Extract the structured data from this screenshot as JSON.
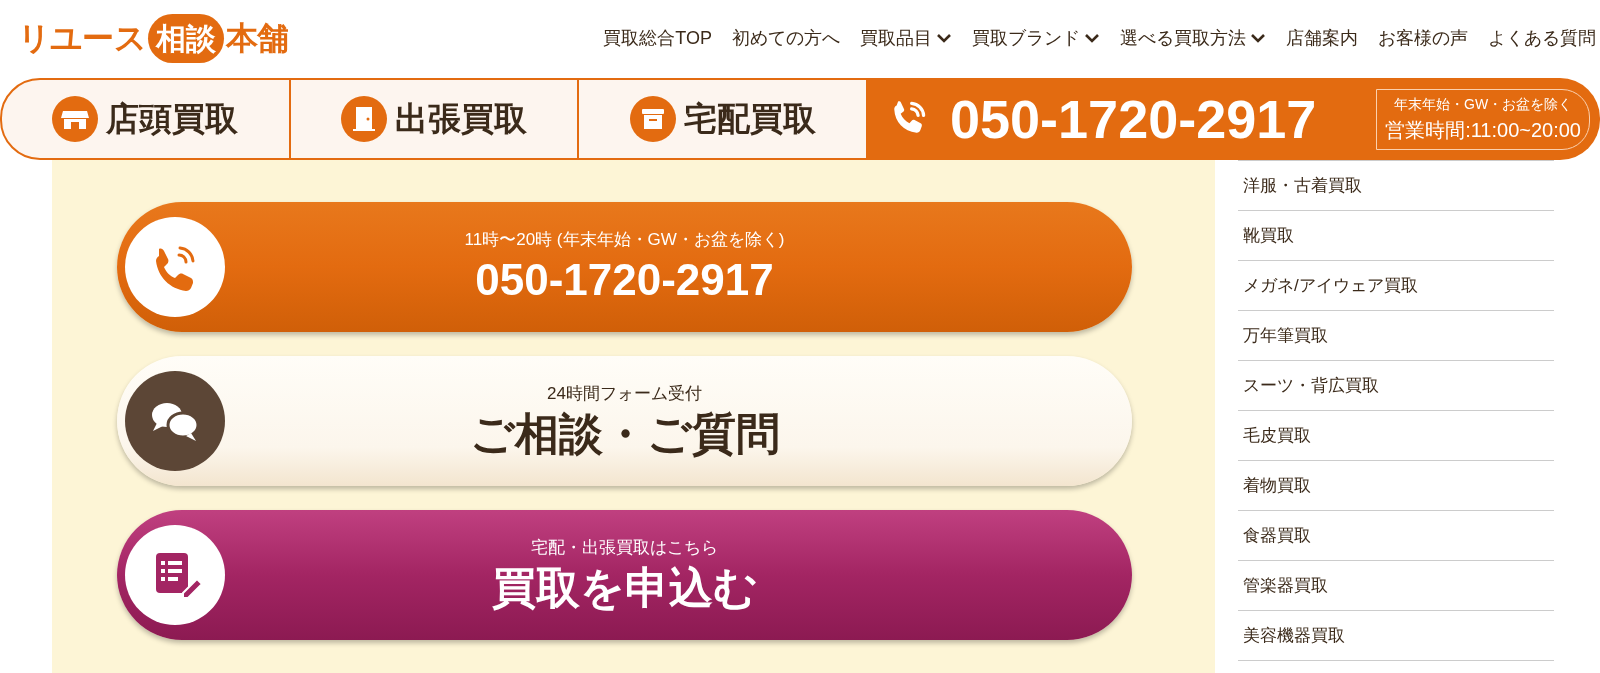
{
  "logo": {
    "parts": [
      {
        "text": "リユース",
        "kind": "plain"
      },
      {
        "text": "相談",
        "kind": "bubble"
      },
      {
        "text": "本舗",
        "kind": "plain"
      }
    ]
  },
  "nav": [
    {
      "label": "買取総合TOP",
      "has_dropdown": false
    },
    {
      "label": "初めての方へ",
      "has_dropdown": false
    },
    {
      "label": "買取品目",
      "has_dropdown": true
    },
    {
      "label": "買取ブランド",
      "has_dropdown": true
    },
    {
      "label": "選べる買取方法",
      "has_dropdown": true
    },
    {
      "label": "店舗案内",
      "has_dropdown": false
    },
    {
      "label": "お客様の声",
      "has_dropdown": false
    },
    {
      "label": "よくある質問",
      "has_dropdown": false
    }
  ],
  "methods": [
    {
      "label": "店頭買取",
      "kind": "store"
    },
    {
      "label": "出張買取",
      "kind": "door"
    },
    {
      "label": "宅配買取",
      "kind": "box"
    }
  ],
  "phone_bar": {
    "number": "050-1720-2917",
    "note": "年末年始・GW・お盆を除く",
    "hours": "営業時間:11:00~20:00"
  },
  "cta_buttons": [
    {
      "kind": "phone",
      "subtitle": "11時〜20時 (年末年始・GW・お盆を除く)",
      "title": "050-1720-2917"
    },
    {
      "kind": "consult",
      "subtitle": "24時間フォーム受付",
      "title": "ご相談・ご質問"
    },
    {
      "kind": "apply",
      "subtitle": "宅配・出張買取はこちら",
      "title": "買取を申込む"
    }
  ],
  "sidebar": {
    "items": [
      "洋服・古着買取",
      "靴買取",
      "メガネ/アイウェア買取",
      "万年筆買取",
      "スーツ・背広買取",
      "毛皮買取",
      "着物買取",
      "食器買取",
      "管楽器買取",
      "美容機器買取"
    ]
  }
}
